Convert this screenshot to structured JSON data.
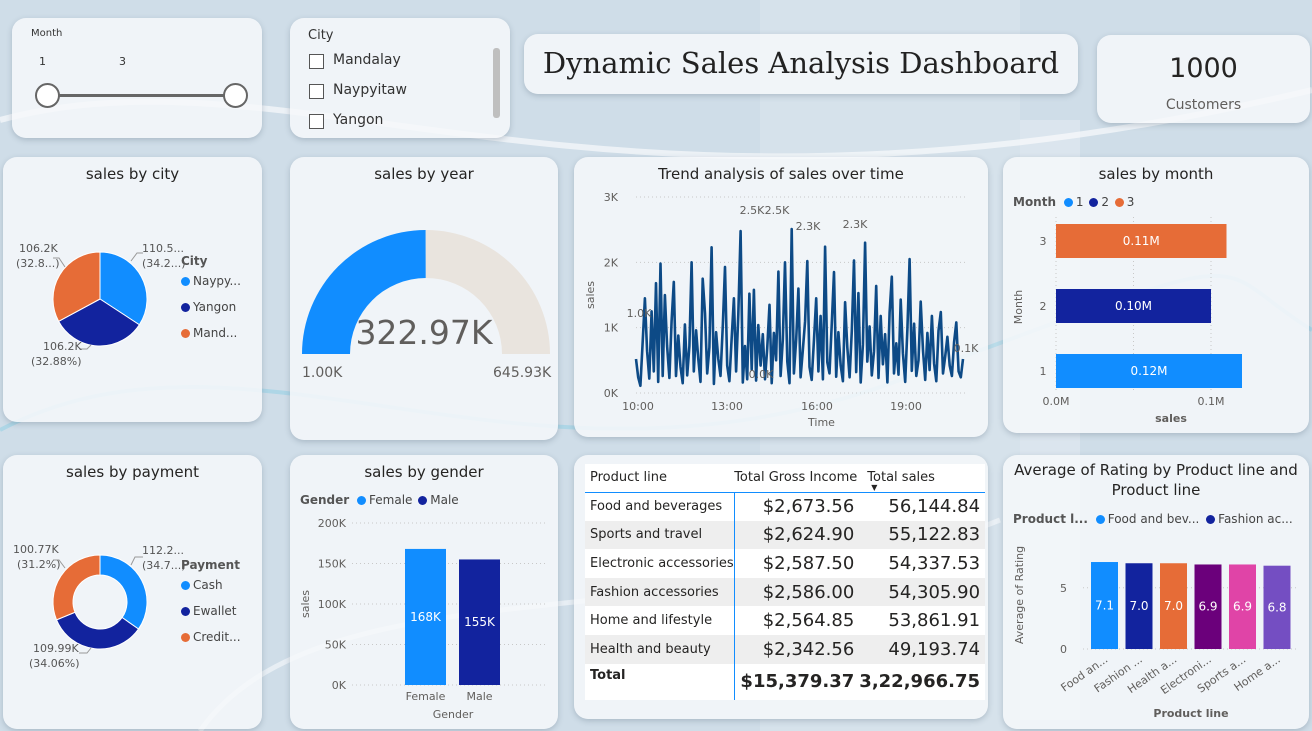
{
  "dashboard": {
    "title": "Dynamic Sales Analysis Dashboard",
    "kpi": {
      "value": "1000",
      "label": "Customers"
    }
  },
  "slicer_month": {
    "label": "Month",
    "min_label": "1",
    "max_label": "3"
  },
  "slicer_city": {
    "label": "City",
    "options": [
      "Mandalay",
      "Naypyitaw",
      "Yangon"
    ]
  },
  "sales_by_city": {
    "title": "sales by city",
    "legend_title": "City",
    "legend": [
      "Naypy...",
      "Yangon",
      "Mand..."
    ],
    "colors": [
      "#118dff",
      "#12239e",
      "#e66c37"
    ],
    "slice_labels": [
      {
        "line1": "110.5...",
        "line2": "(34.2...)"
      },
      {
        "line1": "106.2K",
        "line2": "(32.88%)"
      },
      {
        "line1": "106.2K",
        "line2": "(32.8...)"
      }
    ],
    "chart_data": {
      "type": "pie",
      "categories": [
        "Naypyitaw",
        "Yangon",
        "Mandalay"
      ],
      "values": [
        110.5,
        106.2,
        106.2
      ],
      "percent": [
        34.2,
        32.88,
        32.8
      ]
    }
  },
  "sales_by_year": {
    "title": "sales by year",
    "value_label": "322.97K",
    "min_label": "1.00K",
    "max_label": "645.93K",
    "chart_data": {
      "type": "gauge",
      "value": 322.97,
      "min": 1.0,
      "max": 645.93,
      "unit": "K"
    }
  },
  "trend": {
    "title": "Trend analysis of sales over time",
    "ylabel": "sales",
    "xlabel": "Time",
    "y_ticks": [
      "0K",
      "1K",
      "2K",
      "3K"
    ],
    "x_ticks": [
      "10:00",
      "13:00",
      "16:00",
      "19:00"
    ],
    "annotations": [
      "1.0K",
      "2.5K",
      "2.5K",
      "2.3K",
      "2.3K",
      "0.0K",
      "0.1K"
    ],
    "color": "#0d4a86",
    "chart_data": {
      "type": "line",
      "x_range": [
        "10:00",
        "21:00"
      ],
      "ylim": [
        0,
        3000
      ],
      "series": [
        {
          "values": [
            520,
            240,
            110,
            790,
            1450,
            640,
            220,
            1250,
            330,
            1680,
            170,
            1980,
            260,
            1500,
            720,
            230,
            1100,
            1700,
            260,
            880,
            400,
            150,
            1050,
            270,
            720,
            2000,
            330,
            960,
            520,
            170,
            1750,
            1220,
            300,
            700,
            2230,
            140,
            930,
            520,
            260,
            1030,
            1930,
            420,
            180,
            850,
            1450,
            330,
            1200,
            2480,
            160,
            720,
            210,
            1520,
            360,
            1580,
            190,
            1040,
            420,
            900,
            210,
            680,
            1350,
            150,
            920,
            500,
            1860,
            260,
            810,
            2000,
            480,
            150,
            2510,
            300,
            820,
            1600,
            240,
            650,
            1100,
            2020,
            400,
            200,
            820,
            1450,
            330,
            1180,
            210,
            2240,
            470,
            300,
            1070,
            1850,
            250,
            930,
            420,
            180,
            1390,
            700,
            240,
            950,
            2030,
            320,
            1530,
            160,
            740,
            2300,
            480,
            1020,
            270,
            640,
            1640,
            230,
            1180,
            440,
            900,
            160,
            1230,
            1780,
            300,
            760,
            280,
            1430,
            610,
            170,
            980,
            2050,
            340,
            1060,
            260,
            500,
            1400,
            650,
            200,
            920,
            350,
            1180,
            450,
            180,
            950,
            1240,
            300,
            560,
            860,
            420,
            260,
            780,
            1080,
            330,
            240,
            520
          ]
        }
      ]
    }
  },
  "sales_by_month": {
    "title": "sales by month",
    "legend_title": "Month",
    "legend": [
      "1",
      "2",
      "3"
    ],
    "colors": [
      "#118dff",
      "#12239e",
      "#e66c37"
    ],
    "ylabel": "Month",
    "xlabel": "sales",
    "x_ticks": [
      "0.0M",
      "0.1M"
    ],
    "bar_labels": [
      "0.11M",
      "0.10M",
      "0.12M"
    ],
    "chart_data": {
      "type": "bar",
      "categories": [
        "3",
        "2",
        "1"
      ],
      "values": [
        0.11,
        0.1,
        0.12
      ],
      "unit": "M",
      "xlim": [
        0,
        0.14
      ]
    }
  },
  "sales_by_payment": {
    "title": "sales by payment",
    "legend_title": "Payment",
    "legend": [
      "Cash",
      "Ewallet",
      "Credit..."
    ],
    "colors": [
      "#118dff",
      "#12239e",
      "#e66c37"
    ],
    "slice_labels": [
      {
        "line1": "112.2...",
        "line2": "(34.7...)"
      },
      {
        "line1": "109.99K",
        "line2": "(34.06%)"
      },
      {
        "line1": "100.77K",
        "line2": "(31.2%)"
      }
    ],
    "chart_data": {
      "type": "donut",
      "categories": [
        "Cash",
        "Ewallet",
        "Credit card"
      ],
      "values": [
        112.2,
        109.99,
        100.77
      ],
      "percent": [
        34.7,
        34.06,
        31.2
      ]
    }
  },
  "sales_by_gender": {
    "title": "sales by gender",
    "legend_title": "Gender",
    "legend": [
      "Female",
      "Male"
    ],
    "colors": [
      "#118dff",
      "#12239e"
    ],
    "ylabel": "sales",
    "xlabel": "Gender",
    "y_ticks": [
      "0K",
      "50K",
      "100K",
      "150K",
      "200K"
    ],
    "bar_labels": [
      "168K",
      "155K"
    ],
    "chart_data": {
      "type": "bar",
      "categories": [
        "Female",
        "Male"
      ],
      "values": [
        168,
        155
      ],
      "unit": "K",
      "ylim": [
        0,
        200
      ]
    }
  },
  "product_table": {
    "headers": [
      "Product line",
      "Total Gross Income",
      "Total sales"
    ],
    "rows": [
      [
        "Food and beverages",
        "$2,673.56",
        "56,144.84"
      ],
      [
        "Sports and travel",
        "$2,624.90",
        "55,122.83"
      ],
      [
        "Electronic accessories",
        "$2,587.50",
        "54,337.53"
      ],
      [
        "Fashion accessories",
        "$2,586.00",
        "54,305.90"
      ],
      [
        "Home and lifestyle",
        "$2,564.85",
        "53,861.91"
      ],
      [
        "Health and beauty",
        "$2,342.56",
        "49,193.74"
      ]
    ],
    "total": [
      "Total",
      "$15,379.37",
      "3,22,966.75"
    ]
  },
  "rating": {
    "title_line1": "Average of Rating by Product line and",
    "title_line2": "Product line",
    "legend_title": "Product l...",
    "legend": [
      "Food and bev...",
      "Fashion ac..."
    ],
    "ylabel": "Average of Rating",
    "xlabel": "Product line",
    "y_ticks": [
      "0",
      "5"
    ],
    "bar_labels": [
      "7.1",
      "7.0",
      "7.0",
      "6.9",
      "6.9",
      "6.8"
    ],
    "x_labels": [
      "Food an...",
      "Fashion ...",
      "Health a...",
      "Electroni...",
      "Sports a...",
      "Home a..."
    ],
    "colors": [
      "#118dff",
      "#12239e",
      "#e66c37",
      "#6b007b",
      "#e044a7",
      "#744ec2"
    ],
    "chart_data": {
      "type": "bar",
      "categories": [
        "Food and beverages",
        "Fashion accessories",
        "Health and beauty",
        "Electronic accessories",
        "Sports and travel",
        "Home and lifestyle"
      ],
      "values": [
        7.1,
        7.0,
        7.0,
        6.9,
        6.9,
        6.8
      ],
      "ylim": [
        0,
        8
      ]
    }
  }
}
